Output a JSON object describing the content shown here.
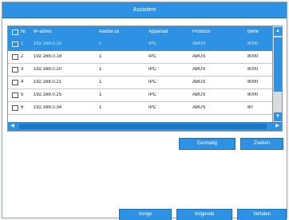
{
  "window": {
    "title": "Assistent"
  },
  "table": {
    "columns": {
      "nr": "Nr",
      "ip": "IP-adres",
      "port": "Aantal ca",
      "device": "Apparaat",
      "protocol": "Protocol",
      "action": "Behe"
    },
    "rows": [
      {
        "nr": "1",
        "ip": "192.168.0.15",
        "port": "1",
        "device": "IPC",
        "protocol": "ABUS",
        "action": "8000",
        "selected": true
      },
      {
        "nr": "2",
        "ip": "192.168.0.18",
        "port": "1",
        "device": "IPC",
        "protocol": "ABUS",
        "action": "8000",
        "selected": false
      },
      {
        "nr": "3",
        "ip": "192.168.0.20",
        "port": "1",
        "device": "IPC",
        "protocol": "ABUS",
        "action": "8000",
        "selected": false
      },
      {
        "nr": "4",
        "ip": "192.168.0.21",
        "port": "1",
        "device": "IPC",
        "protocol": "ABUS",
        "action": "8000",
        "selected": false
      },
      {
        "nr": "5",
        "ip": "192.168.0.25",
        "port": "1",
        "device": "IPC",
        "protocol": "ABUS",
        "action": "8000",
        "selected": false
      },
      {
        "nr": "6",
        "ip": "192.168.0.34",
        "port": "1",
        "device": "IPC",
        "protocol": "ABUS",
        "action": "80",
        "selected": false
      }
    ],
    "scroll_up": "▲",
    "scroll_down": "▼",
    "scroll_left": "◀",
    "scroll_right": "▶"
  },
  "buttons": {
    "edit": "Eenmalig",
    "search": "Zoeken",
    "previous": "Vorige",
    "next": "Volgende",
    "cancel": "Verlaten"
  },
  "colors": {
    "accent": "#2d92e4",
    "window_bg": "#ffffff"
  },
  "icons": {
    "scroll_up": "arrow-up-icon",
    "scroll_down": "arrow-down-icon",
    "scroll_left": "arrow-left-icon",
    "scroll_right": "arrow-right-icon"
  }
}
